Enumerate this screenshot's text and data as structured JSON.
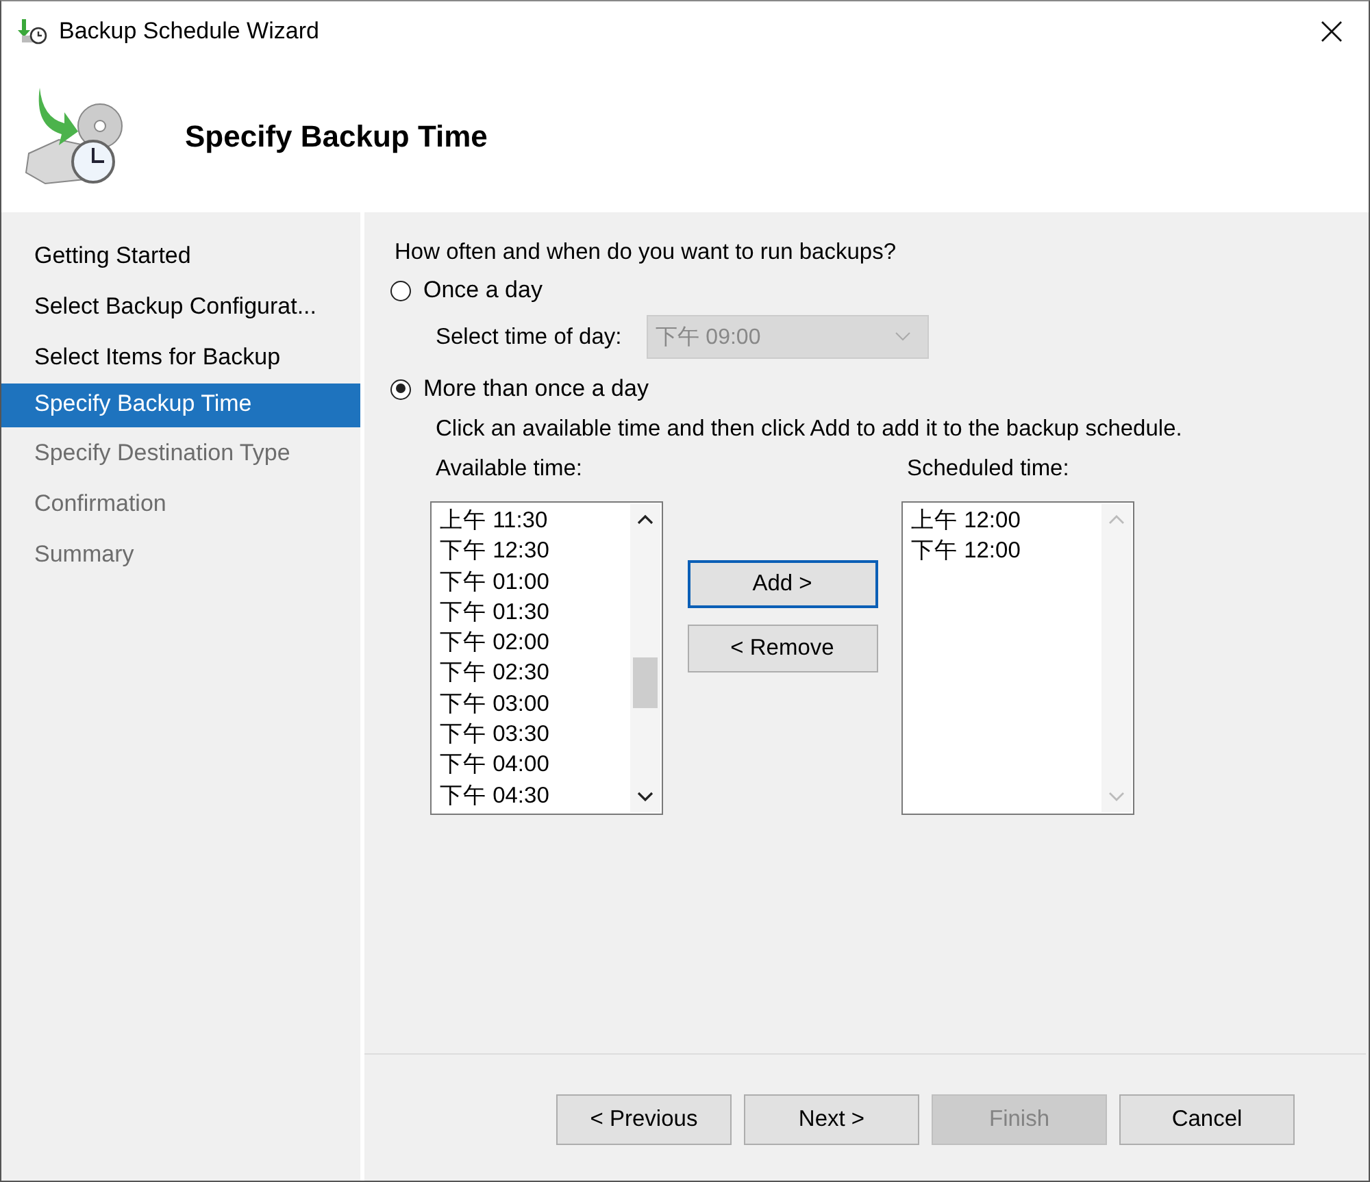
{
  "window": {
    "title": "Backup Schedule Wizard"
  },
  "header": {
    "title": "Specify Backup Time"
  },
  "sidebar": {
    "items": [
      {
        "label": "Getting Started",
        "selected": false,
        "disabled": false
      },
      {
        "label": "Select Backup Configurat...",
        "selected": false,
        "disabled": false
      },
      {
        "label": "Select Items for Backup",
        "selected": false,
        "disabled": false
      },
      {
        "label": "Specify Backup Time",
        "selected": true,
        "disabled": false
      },
      {
        "label": "Specify Destination Type",
        "selected": false,
        "disabled": true
      },
      {
        "label": "Confirmation",
        "selected": false,
        "disabled": true
      },
      {
        "label": "Summary",
        "selected": false,
        "disabled": true
      }
    ]
  },
  "question": "How often and when do you want to run backups?",
  "options": [
    {
      "label": "Once a day",
      "selected": false
    },
    {
      "label": "More than once a day",
      "selected": true
    }
  ],
  "time_of_day": {
    "label": "Select time of day:",
    "value": "下午 09:00",
    "disabled": true
  },
  "instruction": "Click an available time and then click Add to add it to the backup schedule.",
  "available": {
    "label": "Available time:",
    "items": [
      "上午 11:30",
      "下午 12:30",
      "下午 01:00",
      "下午 01:30",
      "下午 02:00",
      "下午 02:30",
      "下午 03:00",
      "下午 03:30",
      "下午 04:00",
      "下午 04:30"
    ]
  },
  "scheduled": {
    "label": "Scheduled time:",
    "items": [
      "上午 12:00",
      "下午 12:00"
    ]
  },
  "move_buttons": [
    {
      "label": "Add >",
      "focused": true
    },
    {
      "label": "< Remove",
      "focused": false
    }
  ],
  "footer_buttons": [
    {
      "label": "< Previous",
      "disabled": false
    },
    {
      "label": "Next >",
      "disabled": false
    },
    {
      "label": "Finish",
      "disabled": true
    },
    {
      "label": "Cancel",
      "disabled": false
    }
  ]
}
